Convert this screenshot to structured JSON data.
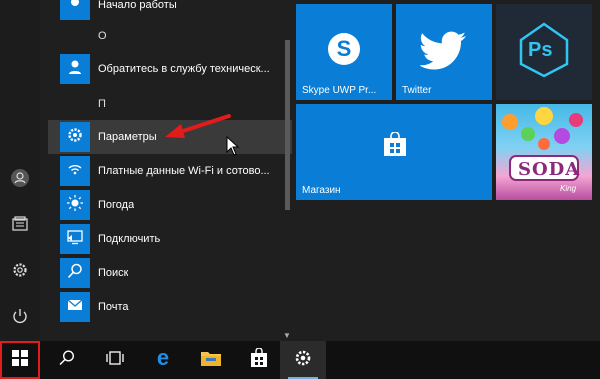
{
  "colors": {
    "accent": "#0a7ed7",
    "skype": "#00a4e8",
    "twitter": "#1ba0f2",
    "arrow": "#e41b1b",
    "ps_bg": "#1f2a36",
    "ps_accent": "#31c5f4"
  },
  "app_list": {
    "top_item": "Начало работы",
    "letter_o": "О",
    "items_o": [
      {
        "label": "Обратитесь в службу техническ...",
        "icon": "support-person-icon"
      }
    ],
    "letter_p": "П",
    "items_p": [
      {
        "label": "Параметры",
        "icon": "gear-icon"
      },
      {
        "label": "Платные данные Wi-Fi и сотово...",
        "icon": "wifi-data-icon"
      },
      {
        "label": "Погода",
        "icon": "sun-icon"
      },
      {
        "label": "Подключить",
        "icon": "connect-icon"
      },
      {
        "label": "Поиск",
        "icon": "search-icon"
      },
      {
        "label": "Почта",
        "icon": "mail-icon"
      }
    ]
  },
  "tiles": {
    "skype": "Skype UWP Pr...",
    "twitter": "Twitter",
    "store": "Магазин",
    "photoshop_logo": "Ps",
    "candy_logo": "SODA",
    "candy_sub": "King"
  },
  "rail": [
    "user-icon",
    "documents-icon",
    "settings-icon",
    "power-icon"
  ],
  "taskbar": [
    "start-button",
    "search-button",
    "task-view-button",
    "edge-button",
    "explorer-button",
    "store-button",
    "settings-button"
  ]
}
